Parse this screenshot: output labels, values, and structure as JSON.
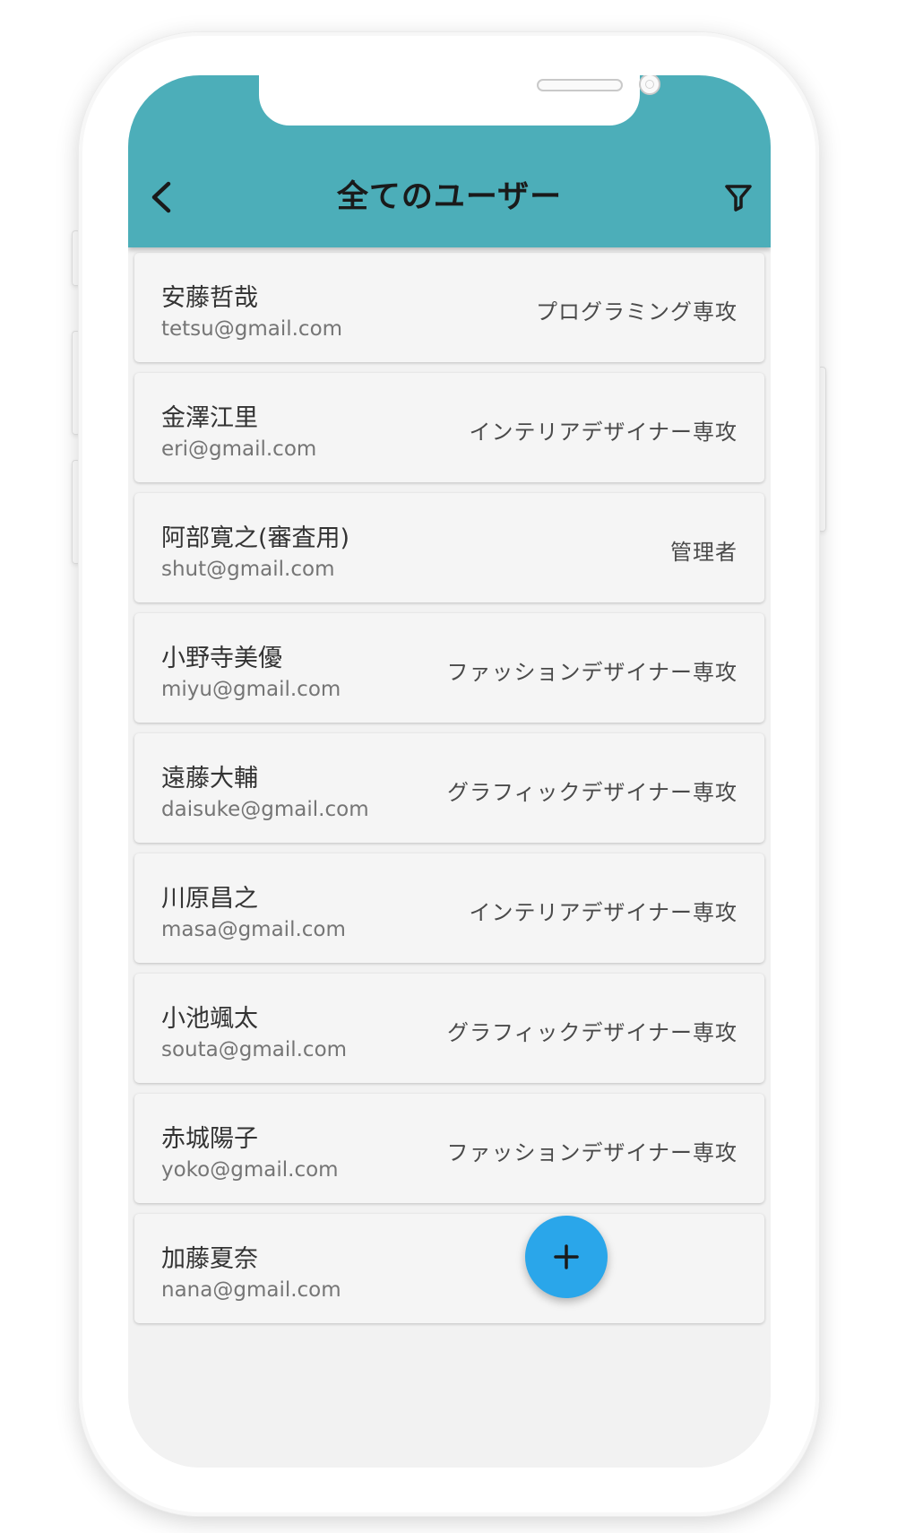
{
  "app": {
    "title": "全てのユーザー",
    "accent_color": "#4caeb9",
    "fab_color": "#2aa6ea"
  },
  "header": {
    "back_icon": "chevron-left-icon",
    "filter_icon": "filter-icon"
  },
  "users": [
    {
      "name": "安藤哲哉",
      "email": "tetsu@gmail.com",
      "role": "プログラミング専攻"
    },
    {
      "name": "金澤江里",
      "email": "eri@gmail.com",
      "role": "インテリアデザイナー専攻"
    },
    {
      "name": "阿部寛之(審査用)",
      "email": "shut@gmail.com",
      "role": "管理者"
    },
    {
      "name": "小野寺美優",
      "email": "miyu@gmail.com",
      "role": "ファッションデザイナー専攻"
    },
    {
      "name": "遠藤大輔",
      "email": "daisuke@gmail.com",
      "role": "グラフィックデザイナー専攻"
    },
    {
      "name": "川原昌之",
      "email": "masa@gmail.com",
      "role": "インテリアデザイナー専攻"
    },
    {
      "name": "小池颯太",
      "email": "souta@gmail.com",
      "role": "グラフィックデザイナー専攻"
    },
    {
      "name": "赤城陽子",
      "email": "yoko@gmail.com",
      "role": "ファッションデザイナー専攻"
    },
    {
      "name": "加藤夏奈",
      "email": "nana@gmail.com",
      "role": ""
    }
  ],
  "fab": {
    "icon": "plus-icon"
  }
}
